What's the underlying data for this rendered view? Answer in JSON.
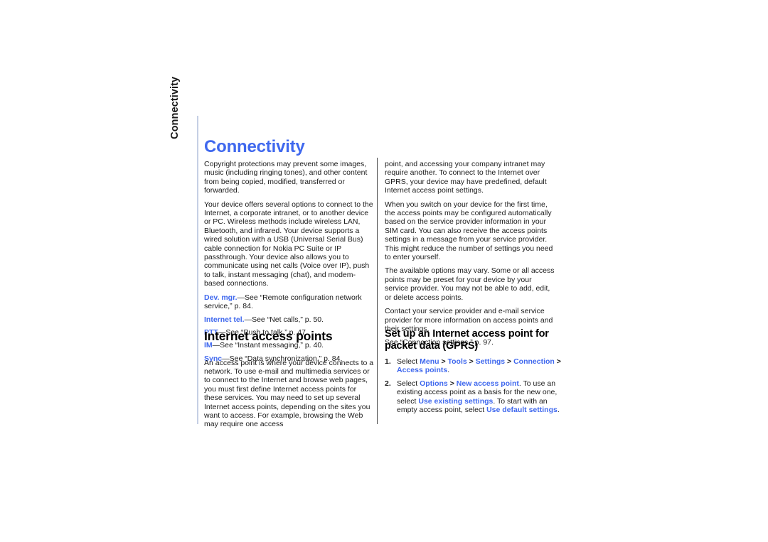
{
  "page": {
    "chapter_tab": "Connectivity",
    "title": "Connectivity"
  },
  "colors": {
    "accent_blue": "#3f68ee",
    "text": "#1a1a1a",
    "edge_rule": "#c5cfe4",
    "column_rule": "#4c4c4c",
    "background": "#ffffff"
  },
  "left_column": {
    "paragraphs": [
      "Copyright protections may prevent some images, music (including ringing tones), and other content from being copied, modified, transferred or forwarded.",
      "Your device offers several options to connect to the Internet, a corporate intranet, or to another device or PC. Wireless methods include wireless LAN, Bluetooth, and infrared. Your device supports a wired solution with a USB (Universal Serial Bus) cable connection for Nokia PC Suite or IP passthrough. Your device also allows you to communicate using net calls (Voice over IP), push to talk, instant messaging (chat), and modem-based connections."
    ],
    "references": [
      {
        "term": "Dev. mgr.",
        "rest": "—See “Remote configuration network service,” p. 84."
      },
      {
        "term": "Internet tel.",
        "rest": "—See “Net calls,” p. 50."
      },
      {
        "term": "PTT",
        "rest": "—See “Push to talk,” p. 47."
      },
      {
        "term": "IM",
        "rest": "—See “Instant messaging,” p. 40."
      },
      {
        "term": "Sync",
        "rest": "—See “Data synchronization,” p. 84."
      }
    ],
    "section": {
      "heading": "Internet access points",
      "body": "An access point is where your device connects to a network. To use e-mail and multimedia services or to connect to the Internet and browse web pages, you must first define Internet access points for these services. You may need to set up several Internet access points, depending on the sites you want to access. For example, browsing the Web may require one access"
    }
  },
  "right_column": {
    "paragraphs": [
      "point, and accessing your company intranet may require another. To connect to the Internet over GPRS, your device may have predefined, default Internet access point settings.",
      "When you switch on your device for the first time, the access points may be configured automatically based on the service provider information in your SIM card. You can also receive the access points settings in a message from your service provider. This might reduce the number of settings you need to enter yourself.",
      "The available options may vary. Some or all access points may be preset for your device by your service provider. You may not be able to add, edit, or delete access points.",
      "Contact your service provider and e-mail service provider for more information on access points and their settings.",
      "See “Connection settings,” p. 97."
    ],
    "section": {
      "heading": "Set up an Internet access point for packet data (GPRS)",
      "steps": [
        {
          "number": "1.",
          "lead": "Select ",
          "path": [
            "Menu",
            "Tools",
            "Settings",
            "Connection",
            "Access points"
          ],
          "separator": " > ",
          "trail": "."
        },
        {
          "number": "2.",
          "lead": "Select ",
          "options_term": "Options",
          "separator": " > ",
          "new_term": "New access point",
          "mid1": ". To use an existing access point as a basis for the new one, select ",
          "existing_term": "Use existing settings",
          "mid2": ". To start with an empty access point, select ",
          "default_term": "Use default settings",
          "trail": "."
        }
      ]
    }
  }
}
